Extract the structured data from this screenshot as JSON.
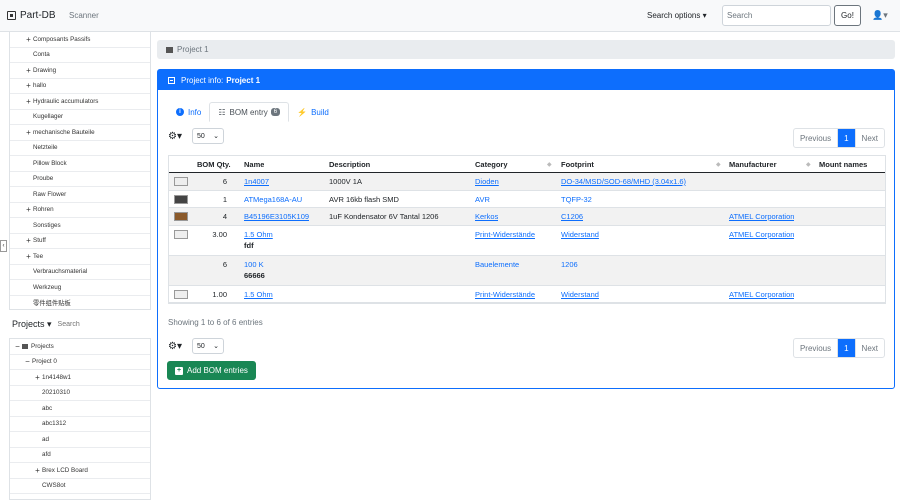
{
  "navbar": {
    "brand": "Part-DB",
    "scanner": "Scanner",
    "search_options": "Search options ▾",
    "search_placeholder": "Search",
    "go_label": "Go!",
    "user_icon": "👤▾"
  },
  "sidebar": {
    "categories": [
      {
        "toggle": "+",
        "label": "Composants Passifs"
      },
      {
        "toggle": "",
        "label": "Conta"
      },
      {
        "toggle": "+",
        "label": "Drawing"
      },
      {
        "toggle": "+",
        "label": "hallo"
      },
      {
        "toggle": "+",
        "label": "Hydraulic accumulators"
      },
      {
        "toggle": "",
        "label": "Kugellager"
      },
      {
        "toggle": "+",
        "label": "mechanische Bauteile"
      },
      {
        "toggle": "",
        "label": "Netzteile"
      },
      {
        "toggle": "",
        "label": "Pillow Block"
      },
      {
        "toggle": "",
        "label": "Proube"
      },
      {
        "toggle": "",
        "label": "Raw Flower"
      },
      {
        "toggle": "+",
        "label": "Rohren"
      },
      {
        "toggle": "",
        "label": "Sonstiges"
      },
      {
        "toggle": "+",
        "label": "Stuff"
      },
      {
        "toggle": "+",
        "label": "Tee"
      },
      {
        "toggle": "",
        "label": "Verbrauchsmaterial"
      },
      {
        "toggle": "",
        "label": "Werkzeug"
      },
      {
        "toggle": "",
        "label": "零件组件贴板"
      }
    ],
    "projects_title": "Projects ▾",
    "projects_search": "Search",
    "collapse_toggle": "‹",
    "projects": [
      {
        "indent": 0,
        "toggle": "−",
        "label": "Projects"
      },
      {
        "indent": 1,
        "toggle": "−",
        "label": "Project 0"
      },
      {
        "indent": 2,
        "toggle": "+",
        "label": "1n4148w1"
      },
      {
        "indent": 2,
        "toggle": "",
        "label": "20210310"
      },
      {
        "indent": 2,
        "toggle": "",
        "label": "abc"
      },
      {
        "indent": 2,
        "toggle": "",
        "label": "abc1312"
      },
      {
        "indent": 2,
        "toggle": "",
        "label": "ad"
      },
      {
        "indent": 2,
        "toggle": "",
        "label": "afd"
      },
      {
        "indent": 2,
        "toggle": "+",
        "label": "Brex LCD Board"
      },
      {
        "indent": 2,
        "toggle": "",
        "label": "CWS8ot"
      }
    ]
  },
  "breadcrumb": "Project 1",
  "card": {
    "header_prefix": "Project info:",
    "header_name": "Project 1",
    "tabs": [
      {
        "icon": "i",
        "label": "Info"
      },
      {
        "icon": "☷",
        "label": "BOM entry",
        "badge": "6"
      },
      {
        "icon": "⚡",
        "label": "Build"
      }
    ],
    "page_length": "50",
    "pager": {
      "prev": "Previous",
      "page": "1",
      "next": "Next"
    },
    "columns": [
      "BOM Qty.",
      "Name",
      "Description",
      "Category",
      "Footprint",
      "Manufacturer",
      "Mount names"
    ],
    "rows": [
      {
        "thumb": "light",
        "qty": "6",
        "name": "1n4007",
        "name_link": true,
        "comment": "",
        "desc": "1000V 1A",
        "cat": "Dioden",
        "cat_link": true,
        "fp": "DO-34/MSD/SOD-68/MHD (3.04x1.6)",
        "fp_link": true,
        "man": "",
        "mount": ""
      },
      {
        "thumb": "dark",
        "qty": "1",
        "name": "ATMega168A-AU",
        "name_link": false,
        "comment": "",
        "desc": "AVR 16kb flash SMD",
        "cat": "AVR",
        "cat_link": false,
        "fp": "TQFP-32",
        "fp_link": false,
        "man": "",
        "mount": ""
      },
      {
        "thumb": "brown",
        "qty": "4",
        "name": "B45196E3105K109",
        "name_link": true,
        "comment": "",
        "desc": "1uF Kondensator 6V Tantal 1206",
        "cat": "Kerkos",
        "cat_link": true,
        "fp": "C1206",
        "fp_link": true,
        "man": "ATMEL Corporation",
        "mount": ""
      },
      {
        "thumb": "light",
        "qty": "3.00",
        "name": "1.5 Ohm",
        "name_link": true,
        "comment": "fdf",
        "desc": "",
        "cat": "Print-Widerstände",
        "cat_link": true,
        "fp": "Widerstand",
        "fp_link": true,
        "man": "ATMEL Corporation",
        "mount": ""
      },
      {
        "thumb": "",
        "qty": "6",
        "name": "100 K",
        "name_link": false,
        "comment": "66666",
        "desc": "",
        "cat": "Bauelemente",
        "cat_link": false,
        "fp": "1206",
        "fp_link": false,
        "man": "",
        "mount": ""
      },
      {
        "thumb": "light",
        "qty": "1.00",
        "name": "1.5 Ohm",
        "name_link": true,
        "comment": "",
        "desc": "",
        "cat": "Print-Widerstände",
        "cat_link": true,
        "fp": "Widerstand",
        "fp_link": true,
        "man": "ATMEL Corporation",
        "mount": ""
      }
    ],
    "info_text": "Showing 1 to 6 of 6 entries",
    "add_button": "Add BOM entries"
  }
}
